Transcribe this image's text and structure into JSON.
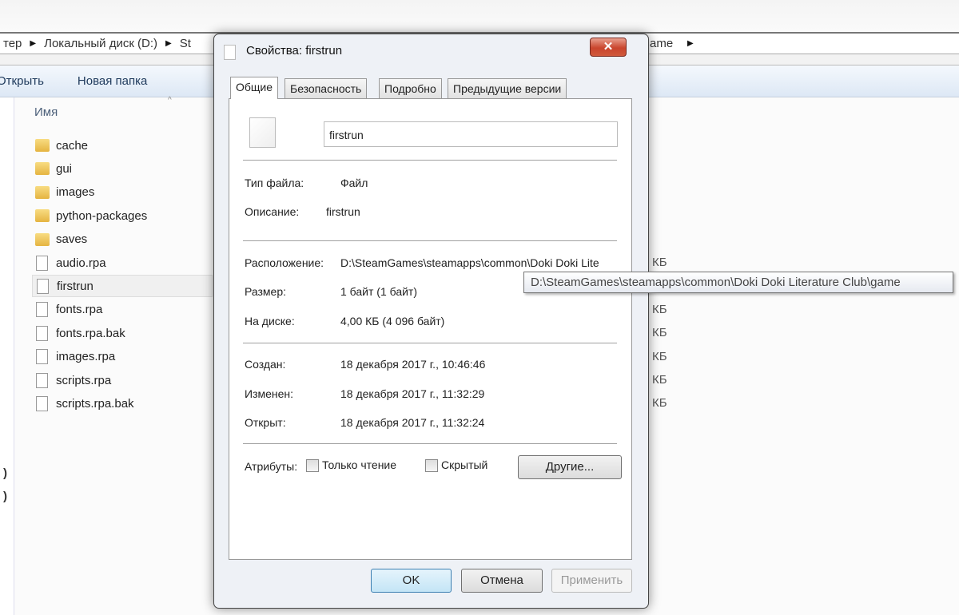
{
  "explorer": {
    "breadcrumb": [
      "тер",
      "Локальный диск (D:)",
      "St",
      "ame"
    ],
    "toolbar": {
      "open": "Открыть",
      "new_folder": "Новая папка"
    },
    "column_name": "Имя",
    "files": [
      {
        "name": "cache",
        "type": "folder"
      },
      {
        "name": "gui",
        "type": "folder"
      },
      {
        "name": "images",
        "type": "folder"
      },
      {
        "name": "python-packages",
        "type": "folder"
      },
      {
        "name": "saves",
        "type": "folder"
      },
      {
        "name": "audio.rpa",
        "type": "file",
        "size": "КБ"
      },
      {
        "name": "firstrun",
        "type": "file",
        "selected": true
      },
      {
        "name": "fonts.rpa",
        "type": "file",
        "size": "КБ"
      },
      {
        "name": "fonts.rpa.bak",
        "type": "file",
        "size": "КБ"
      },
      {
        "name": "images.rpa",
        "type": "file",
        "size": "КБ"
      },
      {
        "name": "scripts.rpa",
        "type": "file",
        "size": "КБ"
      },
      {
        "name": "scripts.rpa.bak",
        "type": "file",
        "size": "КБ"
      }
    ],
    "nav_fragments": [
      ")",
      ")"
    ]
  },
  "dialog": {
    "title": "Свойства: firstrun",
    "close": "✕",
    "tabs": [
      "Общие",
      "Безопасность",
      "Подробно",
      "Предыдущие версии"
    ],
    "filename": "firstrun",
    "type_label": "Тип файла:",
    "type_value": "Файл",
    "desc_label": "Описание:",
    "desc_value": "firstrun",
    "location_label": "Расположение:",
    "location_value": "D:\\SteamGames\\steamapps\\common\\Doki Doki Lite",
    "size_label": "Размер:",
    "size_value": "1 байт (1 байт)",
    "disk_label": "На диске:",
    "disk_value": "4,00 КБ (4 096 байт)",
    "created_label": "Создан:",
    "created_value": "18 декабря 2017 г., 10:46:46",
    "modified_label": "Изменен:",
    "modified_value": "18 декабря 2017 г., 11:32:29",
    "opened_label": "Открыт:",
    "opened_value": "18 декабря 2017 г., 11:32:24",
    "attributes_label": "Атрибуты:",
    "readonly_label": "Только чтение",
    "readonly_checked": false,
    "hidden_label": "Скрытый",
    "hidden_checked": false,
    "other_button": "Другие...",
    "ok": "OK",
    "cancel": "Отмена",
    "apply": "Применить"
  },
  "tooltip": "D:\\SteamGames\\steamapps\\common\\Doki Doki Literature Club\\game",
  "colors": {
    "close_red": "#c9452d",
    "toolbar_blue": "#dde8f5",
    "default_button": "#c4e5f6"
  }
}
